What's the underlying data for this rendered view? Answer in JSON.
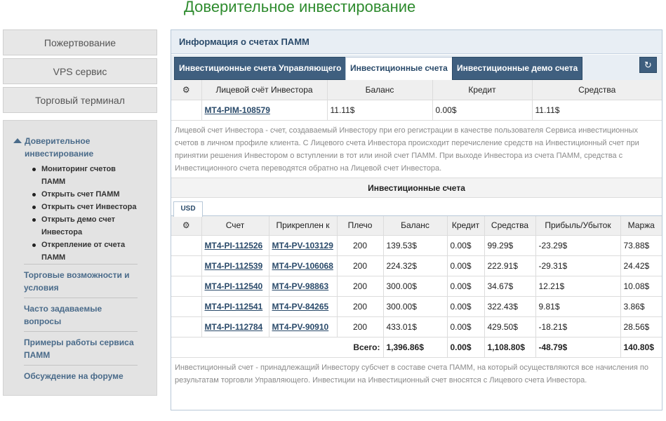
{
  "page_title": "Доверительное инвестирование",
  "sidebar": {
    "buttons": [
      "Пожертвование",
      "VPS сервис",
      "Торговый терминал"
    ],
    "section_title": "Доверительное инвестирование",
    "sub_items": [
      "Мониторинг счетов ПАММ",
      "Открыть счет ПАММ",
      "Открыть счет Инвестора",
      "Открыть демо счет Инвестора",
      "Открепление от счета ПАММ"
    ],
    "links": [
      "Торговые возможности и условия",
      "Часто задаваемые вопросы",
      "Примеры работы сервиса ПАММ",
      "Обсуждение на форуме"
    ]
  },
  "panel": {
    "title": "Информация о счетах ПАММ",
    "tabs": [
      "Инвестиционные счета Управляющего",
      "Инвестиционные счета",
      "Инвестиционные демо счета"
    ],
    "active_tab": "Инвестиционные счета",
    "refresh_icon": "refresh-icon"
  },
  "investor_table": {
    "headers": [
      "⚙",
      "Лицевой счёт Инвестора",
      "Баланс",
      "Кредит",
      "Средства"
    ],
    "row": {
      "account": "MT4-PIM-108579",
      "balance": "11.11$",
      "credit": "0.00$",
      "equity": "11.11$"
    }
  },
  "investor_note": "Лицевой счет Инвестора - счет, создаваемый Инвестору при его регистрации в качестве пользователя Сервиса инвестиционных счетов в личном профиле клиента. С Лицевого счета Инвестора происходит перечисление средств на Инвестиционный счет при принятии решения Инвестором о вступлении в тот или иной счет ПАММ. При выходе Инвестора из счета ПАММ, средства с Инвестиционного счета переводятся обратно на Лицевой счет Инвестора.",
  "investment_section": {
    "title": "Инвестиционные счета",
    "currency_tab": "USD",
    "headers": [
      "⚙",
      "Счет",
      "Прикреплен к",
      "Плечо",
      "Баланс",
      "Кредит",
      "Средства",
      "Прибыль/Убыток",
      "Маржа"
    ],
    "rows": [
      {
        "account": "MT4-PI-112526",
        "attached": "MT4-PV-103129",
        "leverage": "200",
        "balance": "139.53$",
        "credit": "0.00$",
        "equity": "99.29$",
        "pnl": "-23.29$",
        "margin": "73.88$"
      },
      {
        "account": "MT4-PI-112539",
        "attached": "MT4-PV-106068",
        "leverage": "200",
        "balance": "224.32$",
        "credit": "0.00$",
        "equity": "222.91$",
        "pnl": "-29.31$",
        "margin": "24.42$"
      },
      {
        "account": "MT4-PI-112540",
        "attached": "MT4-PV-98863",
        "leverage": "200",
        "balance": "300.00$",
        "credit": "0.00$",
        "equity": "34.67$",
        "pnl": "12.21$",
        "margin": "10.08$"
      },
      {
        "account": "MT4-PI-112541",
        "attached": "MT4-PV-84265",
        "leverage": "200",
        "balance": "300.00$",
        "credit": "0.00$",
        "equity": "322.43$",
        "pnl": "9.81$",
        "margin": "3.86$"
      },
      {
        "account": "MT4-PI-112784",
        "attached": "MT4-PV-90910",
        "leverage": "200",
        "balance": "433.01$",
        "credit": "0.00$",
        "equity": "429.50$",
        "pnl": "-18.21$",
        "margin": "28.56$"
      }
    ],
    "total": {
      "label": "Всего:",
      "balance": "1,396.86$",
      "credit": "0.00$",
      "equity": "1,108.80$",
      "pnl": "-48.79$",
      "margin": "140.80$"
    }
  },
  "investment_note": "Инвестиционный счет - принадлежащий Инвестору субсчет в составе счета ПАММ, на который осуществляются все начисления по результатам торговли Управляющего. Инвестиции на Инвестиционный счет вносятся с Лицевого счета Инвестора.",
  "colors": {
    "title_green": "#2e8b2e",
    "tab_dark": "#3f5f7f",
    "link_blue": "#2a4a6a"
  }
}
